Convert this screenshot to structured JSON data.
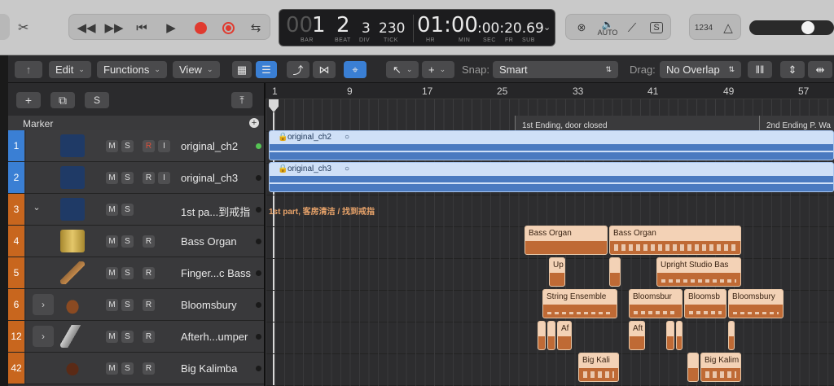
{
  "toolbar": {
    "lcd": {
      "bar_dim": "00",
      "bar": "1",
      "beat": "2",
      "div": "3",
      "tick": "230",
      "time_main": "01:00",
      "time_sub": ":00:20.69",
      "labels": {
        "bar": "BAR",
        "beat": "BEAT",
        "div": "DIV",
        "tick": "TICK",
        "hr": "HR",
        "min": "MIN",
        "sec": "SEC",
        "fr": "FR",
        "sub": "SUB"
      }
    },
    "auto_label": "AUTO",
    "count_in": "1234"
  },
  "menubar": {
    "edit": "Edit",
    "functions": "Functions",
    "view": "View",
    "snap_label": "Snap:",
    "snap_value": "Smart",
    "drag_label": "Drag:",
    "drag_value": "No Overlap"
  },
  "tracklist": {
    "add": "+",
    "s": "S",
    "marker": "Marker",
    "marker_add": "+",
    "tracks": [
      {
        "num": "1",
        "name": "original_ch2",
        "m": "M",
        "s": "S",
        "r": "R",
        "i": "I"
      },
      {
        "num": "2",
        "name": "original_ch3",
        "m": "M",
        "s": "S",
        "r": "R",
        "i": "I"
      },
      {
        "num": "3",
        "name": "1st pa...到戒指",
        "m": "M",
        "s": "S"
      },
      {
        "num": "4",
        "name": "Bass Organ",
        "m": "M",
        "s": "S",
        "r": "R"
      },
      {
        "num": "5",
        "name": "Finger...c Bass",
        "m": "M",
        "s": "S",
        "r": "R"
      },
      {
        "num": "6",
        "name": "Bloomsbury",
        "m": "M",
        "s": "S",
        "r": "R"
      },
      {
        "num": "12",
        "name": "Afterh...umper",
        "m": "M",
        "s": "S",
        "r": "R"
      },
      {
        "num": "42",
        "name": "Big Kalimba",
        "m": "M",
        "s": "S",
        "r": "R"
      }
    ]
  },
  "ruler": [
    "1",
    "9",
    "17",
    "25",
    "33",
    "41",
    "49",
    "57"
  ],
  "markers": [
    "1st Ending, door closed",
    "2nd Ending P. Wa"
  ],
  "regions": {
    "audio1": "original_ch2",
    "audio2": "original_ch3",
    "folder": "1st part, 客房清洁 / 找到戒指",
    "bass_organ_1": "Bass Organ",
    "bass_organ_2": "Bass Organ",
    "up": "Up",
    "upright": "Upright Studio Bas",
    "string": "String Ensemble",
    "bloom1": "Bloomsbur",
    "bloom2": "Bloomsb",
    "bloom3": "Bloomsbury",
    "af1": "Af",
    "af2": "Aft",
    "kali1": "Big Kali",
    "kali2": "Big Kalim"
  },
  "colors": {
    "accent_blue": "#3a7fd4",
    "audio_region": "#4a7ac0",
    "midi_orange": "#bf6a35",
    "track_orange": "#c8661e"
  }
}
